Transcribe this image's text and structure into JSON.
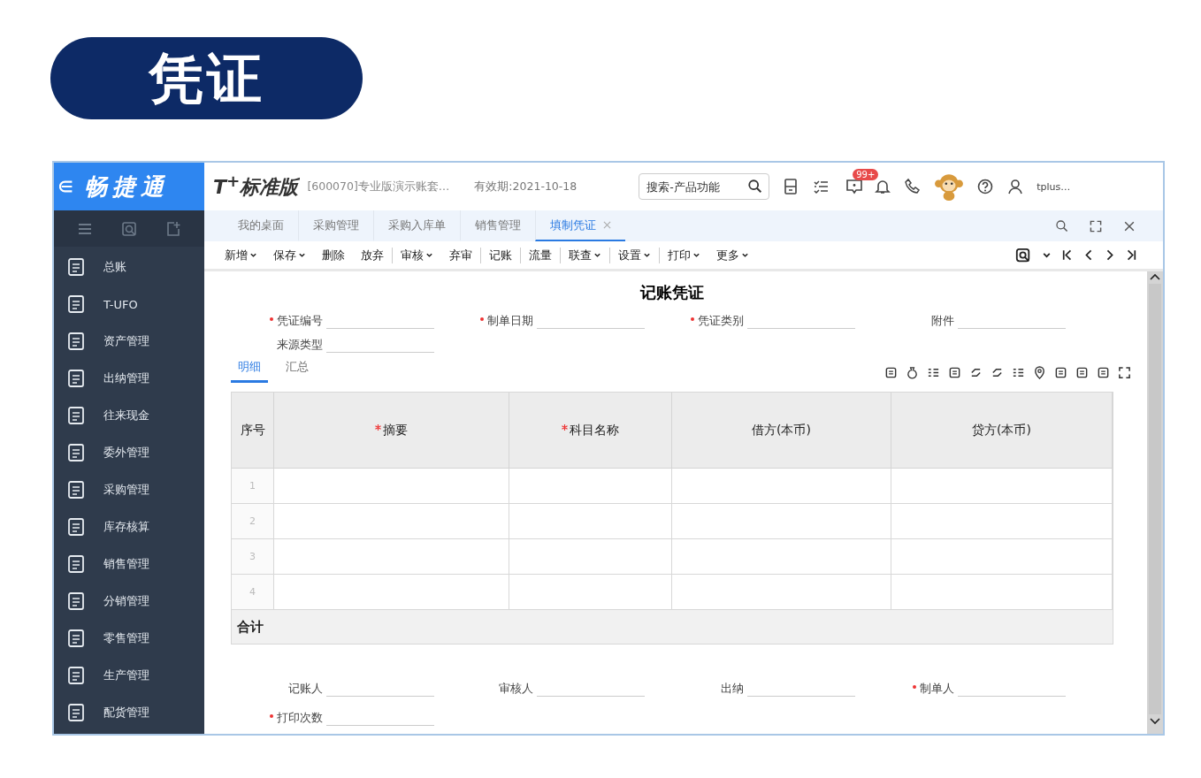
{
  "page_title": "凭证",
  "sidebar": {
    "logo": "畅捷通",
    "items": [
      {
        "label": "总账"
      },
      {
        "label": "T-UFO"
      },
      {
        "label": "资产管理"
      },
      {
        "label": "出纳管理"
      },
      {
        "label": "往来现金"
      },
      {
        "label": "委外管理"
      },
      {
        "label": "采购管理"
      },
      {
        "label": "库存核算"
      },
      {
        "label": "销售管理"
      },
      {
        "label": "分销管理"
      },
      {
        "label": "零售管理"
      },
      {
        "label": "生产管理"
      },
      {
        "label": "配货管理"
      }
    ]
  },
  "header": {
    "product": "T$^{+}$标准版",
    "account": "[600070]专业版演示账套…",
    "validity": "有效期:2021-10-18",
    "search": {
      "placeholder": "搜索-产品功能"
    },
    "badge": "99+",
    "user": "tplus…"
  },
  "tabs": [
    {
      "label": "我的桌面",
      "selected": false
    },
    {
      "label": "采购管理",
      "selected": false
    },
    {
      "label": "采购入库单",
      "selected": false
    },
    {
      "label": "销售管理",
      "selected": false
    },
    {
      "label": "填制凭证",
      "selected": true
    }
  ],
  "toolbar": [
    {
      "label": "新增",
      "dropdown": true,
      "divider_after": false
    },
    {
      "label": "保存",
      "dropdown": true,
      "divider_after": false
    },
    {
      "label": "删除",
      "dropdown": false,
      "divider_after": false
    },
    {
      "label": "放弃",
      "dropdown": false,
      "divider_after": true
    },
    {
      "label": "审核",
      "dropdown": true,
      "divider_after": false
    },
    {
      "label": "弃审",
      "dropdown": false,
      "divider_after": true
    },
    {
      "label": "记账",
      "dropdown": false,
      "divider_after": true
    },
    {
      "label": "流量",
      "dropdown": false,
      "divider_after": true
    },
    {
      "label": "联查",
      "dropdown": true,
      "divider_after": true
    },
    {
      "label": "设置",
      "dropdown": true,
      "divider_after": true
    },
    {
      "label": "打印",
      "dropdown": true,
      "divider_after": false
    },
    {
      "label": "更多",
      "dropdown": true,
      "divider_after": false
    }
  ],
  "voucher": {
    "title": "记账凭证",
    "fields": [
      {
        "label": "凭证编号",
        "required": true
      },
      {
        "label": "制单日期",
        "required": true
      },
      {
        "label": "凭证类别",
        "required": true
      },
      {
        "label": "附件",
        "required": false
      },
      {
        "label": "来源类型",
        "required": false
      }
    ],
    "detail_tabs": [
      {
        "label": "明细",
        "selected": true
      },
      {
        "label": "汇总",
        "selected": false
      }
    ],
    "table": {
      "columns": [
        {
          "label": "序号",
          "required": false
        },
        {
          "label": "摘要",
          "required": true
        },
        {
          "label": "科目名称",
          "required": true
        },
        {
          "label": "借方(本币)",
          "required": false
        },
        {
          "label": "贷方(本币)",
          "required": false
        }
      ],
      "rows": [
        "1",
        "2",
        "3",
        "4"
      ],
      "total_label": "合计"
    },
    "footer_fields": [
      {
        "label": "记账人",
        "required": false
      },
      {
        "label": "审核人",
        "required": false
      },
      {
        "label": "出纳",
        "required": false
      },
      {
        "label": "制单人",
        "required": true
      },
      {
        "label": "打印次数",
        "required": true
      }
    ]
  }
}
